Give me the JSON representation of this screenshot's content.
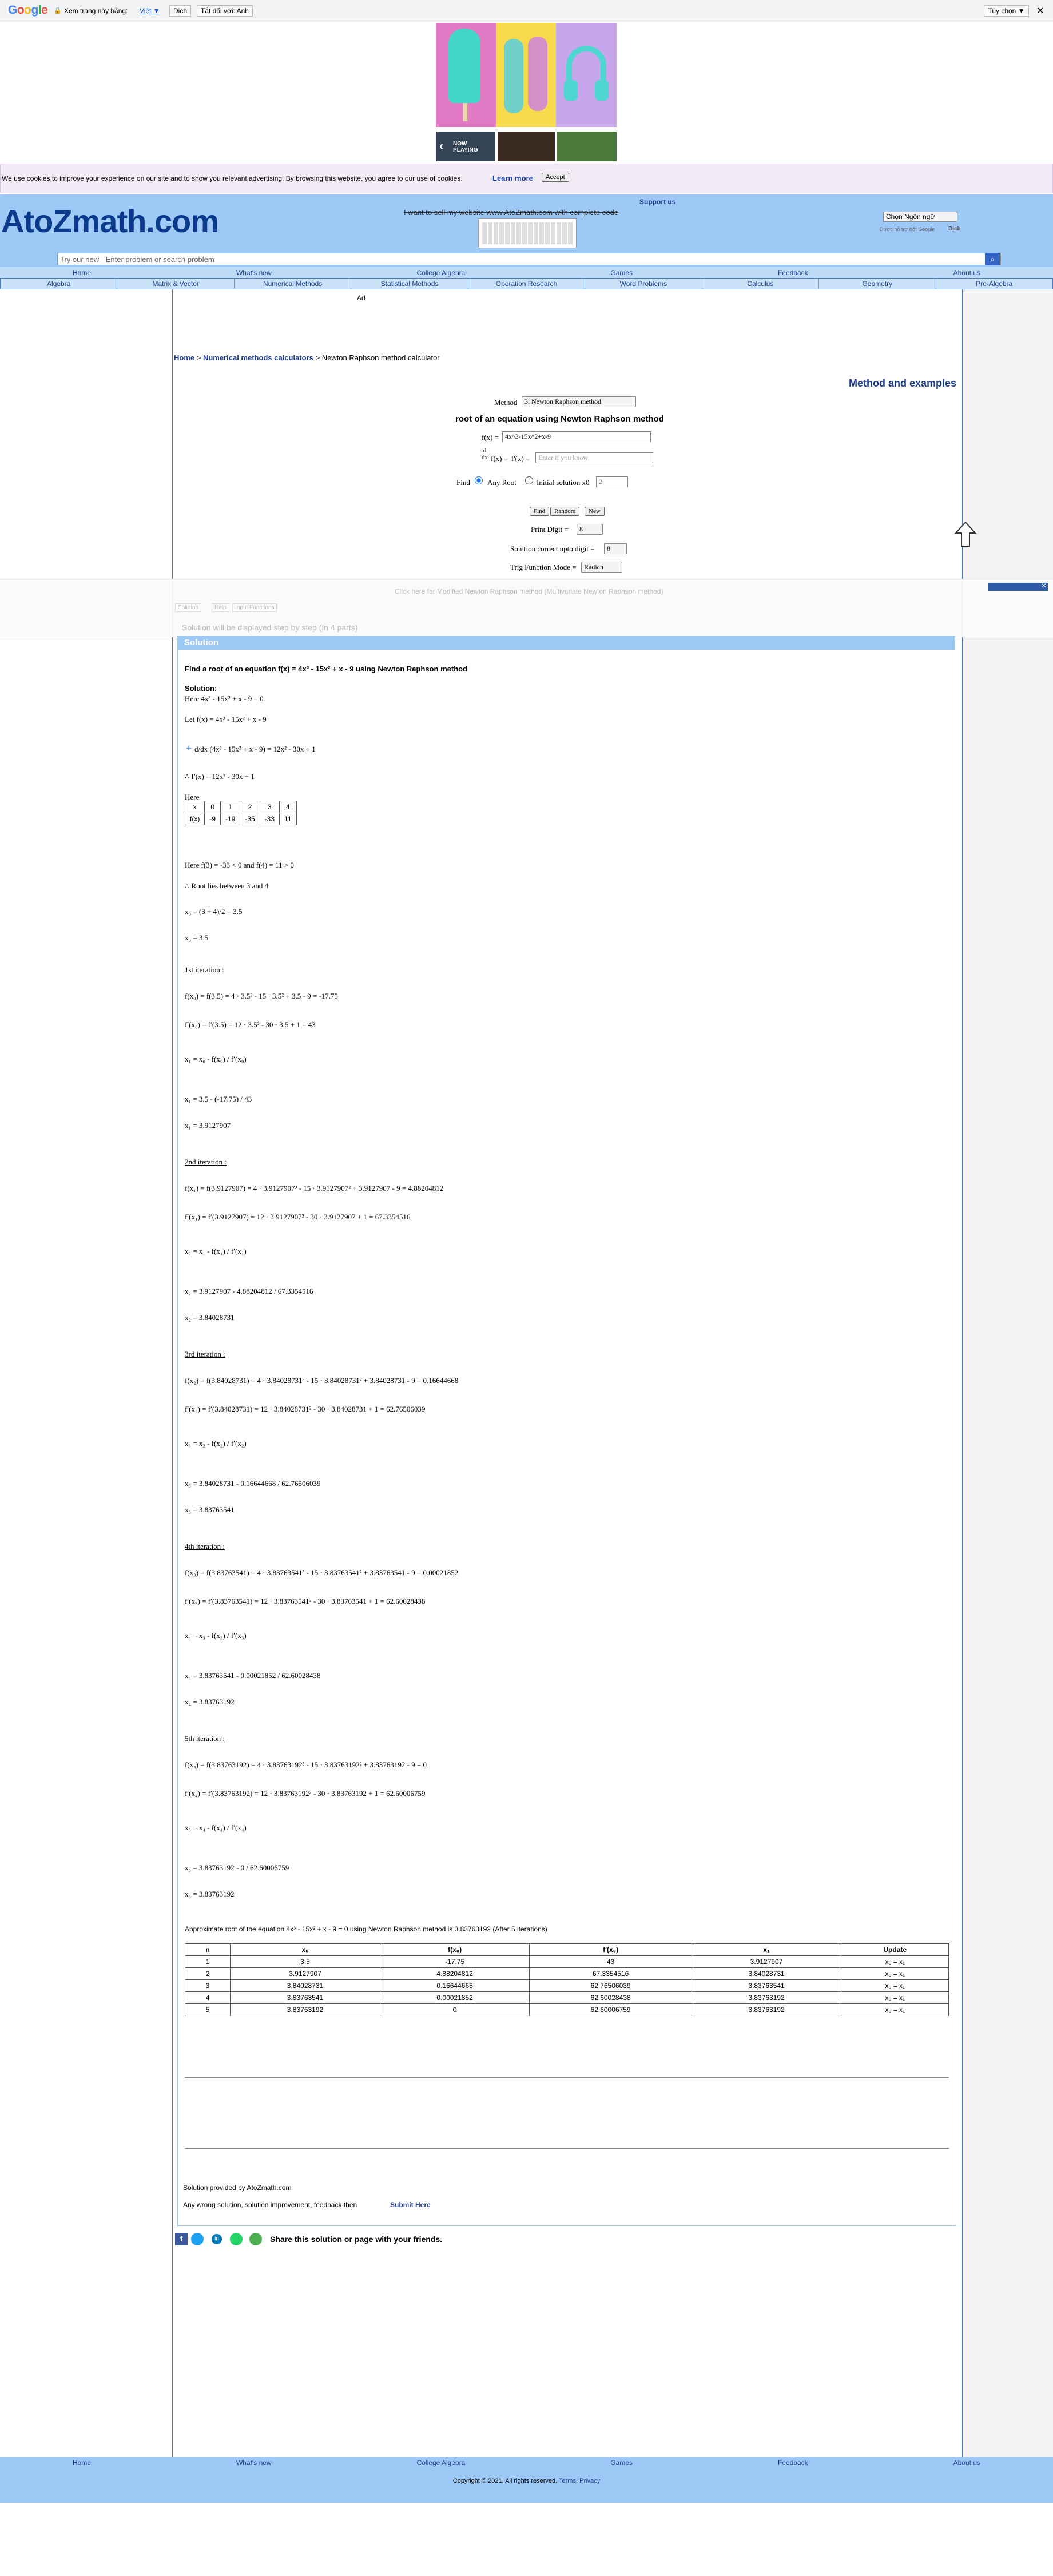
{
  "translate_bar": {
    "google_g1": "G",
    "google_o1": "o",
    "google_o2": "o",
    "google_g2": "g",
    "google_l": "l",
    "google_e": "e",
    "view_label": "Xem trang này bằng:",
    "language": "Việt ▼",
    "translate_btn": "Dịch",
    "turn_off_btn": "Tắt đối với: Anh",
    "options_btn": "Tùy chọn ▼"
  },
  "ads": {
    "now_playing": "NOW PLAYING",
    "ad_label": "Ad"
  },
  "cookie": {
    "text": "We use cookies to improve your experience on our site and to show you relevant advertising. By browsing this website, you agree to our use of cookies.",
    "learn_more": "Learn more",
    "accept": "Accept"
  },
  "header": {
    "logo": "AtoZmath.com",
    "support": "Support us",
    "sell_text": "I want to sell my website www.AtoZmath.com with complete code",
    "lang_select": "Chọn Ngôn ngữ",
    "powered_by": "Được hỗ trợ bởi Google",
    "powered_by_link": "Dịch",
    "search_placeholder": "Try our new - Enter problem or search problem"
  },
  "nav_top": [
    "Home",
    "What's new",
    "College Algebra",
    "Games",
    "Feedback",
    "About us"
  ],
  "nav_menu": [
    "Algebra",
    "Matrix & Vector",
    "Numerical Methods",
    "Statistical Methods",
    "Operation Research",
    "Word Problems",
    "Calculus",
    "Geometry",
    "Pre-Algebra"
  ],
  "breadcrumb": {
    "home": "Home",
    "sep1": " > ",
    "cat": "Numerical methods calculators",
    "sep2": " > ",
    "page": "Newton Raphson method calculator"
  },
  "method_link": "Method and examples",
  "form": {
    "method_label": "Method",
    "method_value": "3. Newton Raphson method",
    "title": "root of an equation using Newton Raphson method",
    "fx_label": "f(x) =",
    "fx_value": "4x^3-15x^2+x-9",
    "dfx_label": "f'(x) =",
    "dfx_placeholder": "Enter if you know",
    "find_label": "Find",
    "any_root": "Any Root",
    "initial_solution": "Initial solution x0",
    "initial_value": "2",
    "find_btn": "Find",
    "random_btn": "Random",
    "new_btn": "New",
    "print_digit_label": "Print Digit =",
    "print_digit_value": "8",
    "correct_label": "Solution correct upto digit =",
    "correct_value": "8",
    "trig_label": "Trig Function Mode =",
    "trig_value": "Radian"
  },
  "overlay": {
    "hint": "Click here for Modified Newton Raphson method (Multivariate Newton Raphson method)",
    "tab1": "Solution",
    "tab2": "Help",
    "tab3": "Input Functions",
    "steps_note": "Solution will be displayed step by step (In 4 parts)"
  },
  "solution": {
    "header": "Solution",
    "problem": "Find a root of an equation f(x) = 4x³ - 15x² + x - 9 using Newton Raphson method",
    "sol_label": "Solution:",
    "l1": "Here 4x³ - 15x² + x - 9 = 0",
    "l2": "Let f(x) = 4x³ - 15x² + x - 9",
    "l3": "d/dx (4x³ - 15x² + x - 9) = 12x² - 30x + 1",
    "l4": "∴ f′(x) = 12x² - 30x + 1",
    "here": "Here",
    "table_x": [
      "x",
      "0",
      "1",
      "2",
      "3",
      "4"
    ],
    "table_f": [
      "f(x)",
      "-9",
      "-19",
      "-35",
      "-33",
      "11"
    ],
    "l5": "Here f(3) = -33 < 0 and f(4) = 11 > 0",
    "l6": "∴ Root lies between 3 and 4",
    "l7": "x₀ = (3 + 4)/2 = 3.5",
    "l8": "x₀ = 3.5",
    "iterations": [
      {
        "title": "1st iteration :",
        "f": "f(x₀) = f(3.5) = 4 · 3.5³ - 15 · 3.5² + 3.5 - 9 = -17.75",
        "df": "f′(x₀) = f′(3.5) = 12 · 3.5² - 30 · 3.5 + 1 = 43",
        "gen": "x₁ = x₀ - f(x₀) / f′(x₀)",
        "sub": "x₁ = 3.5 - (-17.75) / 43",
        "res": "x₁ = 3.9127907"
      },
      {
        "title": "2nd iteration :",
        "f": "f(x₁) = f(3.9127907) = 4 · 3.9127907³ - 15 · 3.9127907² + 3.9127907 - 9 = 4.88204812",
        "df": "f′(x₁) = f′(3.9127907) = 12 · 3.9127907² - 30 · 3.9127907 + 1 = 67.3354516",
        "gen": "x₂ = x₁ - f(x₁) / f′(x₁)",
        "sub": "x₂ = 3.9127907 - 4.88204812 / 67.3354516",
        "res": "x₂ = 3.84028731"
      },
      {
        "title": "3rd iteration :",
        "f": "f(x₂) = f(3.84028731) = 4 · 3.84028731³ - 15 · 3.84028731² + 3.84028731 - 9 = 0.16644668",
        "df": "f′(x₂) = f′(3.84028731) = 12 · 3.84028731² - 30 · 3.84028731 + 1 = 62.76506039",
        "gen": "x₃ = x₂ - f(x₂) / f′(x₂)",
        "sub": "x₃ = 3.84028731 - 0.16644668 / 62.76506039",
        "res": "x₃ = 3.83763541"
      },
      {
        "title": "4th iteration :",
        "f": "f(x₃) = f(3.83763541) = 4 · 3.83763541³ - 15 · 3.83763541² + 3.83763541 - 9 = 0.00021852",
        "df": "f′(x₃) = f′(3.83763541) = 12 · 3.83763541² - 30 · 3.83763541 + 1 = 62.60028438",
        "gen": "x₄ = x₃ - f(x₃) / f′(x₃)",
        "sub": "x₄ = 3.83763541 - 0.00021852 / 62.60028438",
        "res": "x₄ = 3.83763192"
      },
      {
        "title": "5th iteration :",
        "f": "f(x₄) = f(3.83763192) = 4 · 3.83763192³ - 15 · 3.83763192² + 3.83763192 - 9 = 0",
        "df": "f′(x₄) = f′(3.83763192) = 12 · 3.83763192² - 30 · 3.83763192 + 1 = 62.60006759",
        "gen": "x₅ = x₄ - f(x₄) / f′(x₄)",
        "sub": "x₅ = 3.83763192 - 0 / 62.60006759",
        "res": "x₅ = 3.83763192"
      }
    ],
    "approx": "Approximate root of the equation 4x³ - 15x² + x - 9 = 0 using Newton Raphson method is 3.83763192 (After 5 iterations)",
    "result_headers": [
      "n",
      "x₀",
      "f(x₀)",
      "f′(x₀)",
      "x₁",
      "Update"
    ],
    "result_rows": [
      [
        "1",
        "3.5",
        "-17.75",
        "43",
        "3.9127907",
        "x₀ = x₁"
      ],
      [
        "2",
        "3.9127907",
        "4.88204812",
        "67.3354516",
        "3.84028731",
        "x₀ = x₁"
      ],
      [
        "3",
        "3.84028731",
        "0.16644668",
        "62.76506039",
        "3.83763541",
        "x₀ = x₁"
      ],
      [
        "4",
        "3.83763541",
        "0.00021852",
        "62.60028438",
        "3.83763192",
        "x₀ = x₁"
      ],
      [
        "5",
        "3.83763192",
        "0",
        "62.60006759",
        "3.83763192",
        "x₀ = x₁"
      ]
    ],
    "provided_by": "Solution provided by AtoZmath.com",
    "feedback_text": "Any wrong solution, solution improvement, feedback then",
    "submit_here": "Submit Here"
  },
  "share": {
    "text": "Share this solution or page with your friends."
  },
  "footer": {
    "copyright": "Copyright © 2021. All rights reserved.",
    "terms": "Terms",
    "privacy": "Privacy"
  },
  "colors": {
    "header_bg": "#9ec9f6",
    "logo": "#0b3a8c",
    "solution_header": "#9ec9f6",
    "link": "#0000cc"
  }
}
